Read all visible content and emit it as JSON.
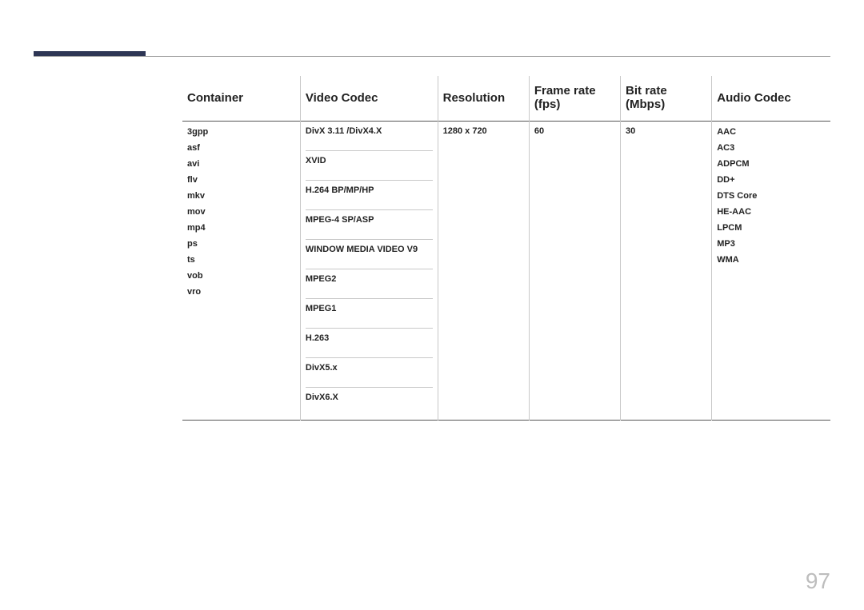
{
  "pageNumber": "97",
  "headers": {
    "container": "Container",
    "videoCodec": "Video Codec",
    "resolution": "Resolution",
    "framerate": "Frame rate (fps)",
    "bitrate": "Bit rate (Mbps)",
    "audioCodec": "Audio Codec"
  },
  "containers": [
    "3gpp",
    "asf",
    "avi",
    "flv",
    "mkv",
    "mov",
    "mp4",
    "ps",
    "ts",
    "vob",
    "vro"
  ],
  "videoCodecs": [
    "DivX 3.11 /DivX4.X",
    "XVID",
    "H.264 BP/MP/HP",
    "MPEG-4 SP/ASP",
    "WINDOW MEDIA VIDEO V9",
    "MPEG2",
    "MPEG1",
    "H.263",
    "DivX5.x",
    "DivX6.X"
  ],
  "resolution": "1280 x 720",
  "framerate": "60",
  "bitrate": "30",
  "audioCodecs": [
    "AAC",
    "AC3",
    "ADPCM",
    "DD+",
    "DTS Core",
    "HE-AAC",
    "LPCM",
    "MP3",
    "WMA"
  ]
}
